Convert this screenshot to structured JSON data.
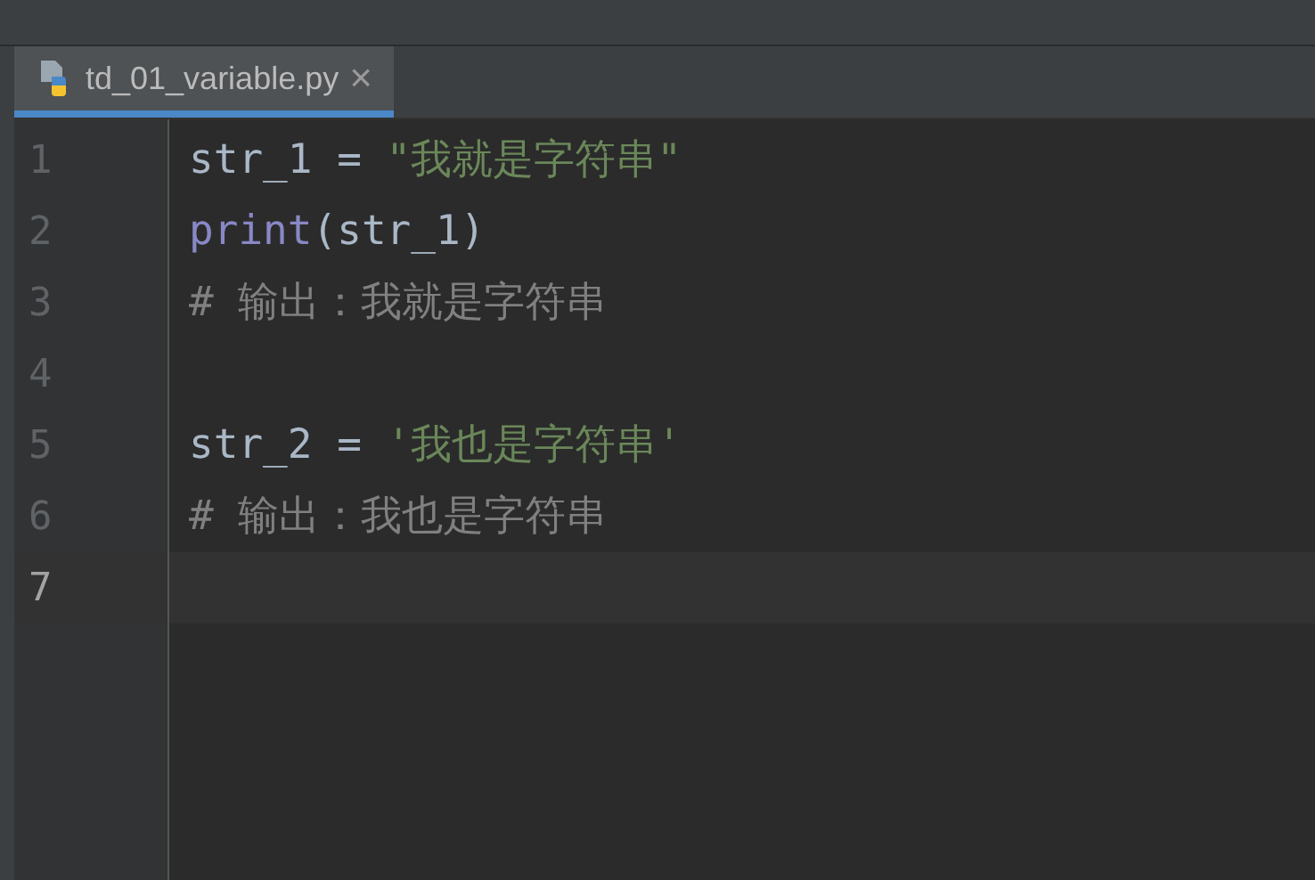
{
  "tabs": [
    {
      "label": "td_01_variable.py",
      "close": "×",
      "selected": true
    }
  ],
  "editor": {
    "lines": [
      {
        "number": "1",
        "current": false,
        "tokens": [
          {
            "kind": "plain",
            "text": "str_1 = "
          },
          {
            "kind": "string",
            "text": "\"我就是字符串\""
          }
        ]
      },
      {
        "number": "2",
        "current": false,
        "tokens": [
          {
            "kind": "builtin",
            "text": "print"
          },
          {
            "kind": "plain",
            "text": "(str_1)"
          }
        ]
      },
      {
        "number": "3",
        "current": false,
        "tokens": [
          {
            "kind": "comment",
            "text": "# 输出：我就是字符串"
          }
        ]
      },
      {
        "number": "4",
        "current": false
      },
      {
        "number": "5",
        "current": false,
        "tokens": [
          {
            "kind": "plain",
            "text": "str_2 = "
          },
          {
            "kind": "string",
            "text": "'我也是字符串'"
          }
        ]
      },
      {
        "number": "6",
        "current": false,
        "tokens": [
          {
            "kind": "comment",
            "text": "# 输出：我也是字符串"
          }
        ]
      },
      {
        "number": "7",
        "current": true
      }
    ]
  }
}
